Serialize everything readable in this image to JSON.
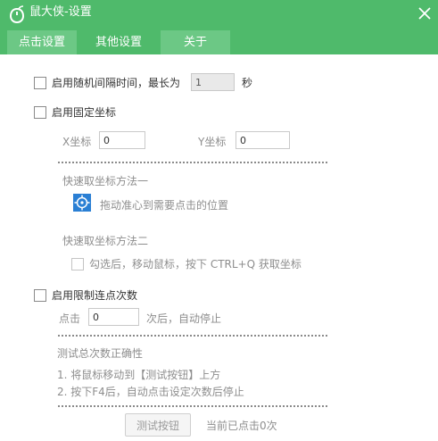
{
  "window": {
    "title": "鼠大侠-设置",
    "close_icon": "close-icon"
  },
  "tabs": [
    {
      "label": "点击设置",
      "active": true
    },
    {
      "label": "其他设置",
      "active": false
    },
    {
      "label": "关于",
      "active": false
    }
  ],
  "random_interval": {
    "label": "启用随机间隔时间，最长为",
    "value": "1",
    "unit": "秒",
    "checked": false
  },
  "fixed_coords": {
    "label": "启用固定坐标",
    "checked": false,
    "x_label": "X坐标",
    "x_value": "0",
    "y_label": "Y坐标",
    "y_value": "0",
    "method1_title": "快速取坐标方法一",
    "method1_hint": "拖动准心到需要点击的位置",
    "method2_title": "快速取坐标方法二",
    "method2_checkbox": "勾选后，移动鼠标，按下 CTRL+Q 获取坐标"
  },
  "limit_clicks": {
    "label": "启用限制连点次数",
    "checked": false,
    "prefix": "点击",
    "value": "0",
    "suffix": "次后，自动停止"
  },
  "test": {
    "title": "测试总次数正确性",
    "step1": "1. 将鼠标移动到【测试按钮】上方",
    "step2": "2. 按下F4后，自动点击设定次数后停止",
    "button_label": "测试按钮",
    "status": "当前已点击0次"
  },
  "colors": {
    "accent": "#4fba6b",
    "tab_active": "#6cc885",
    "icon_blue": "#2a7fd4"
  }
}
